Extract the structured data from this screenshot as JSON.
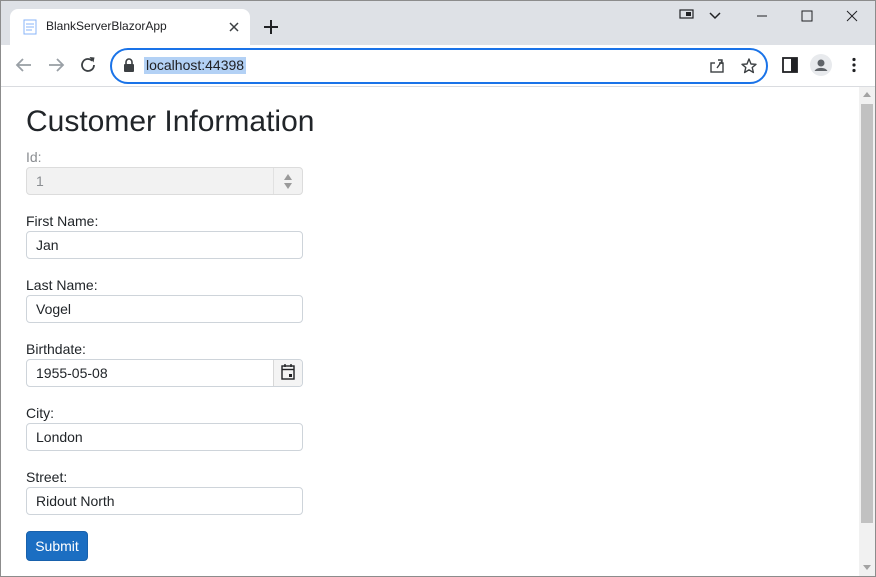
{
  "browser": {
    "tab_title": "BlankServerBlazorApp",
    "url": "localhost:44398",
    "icons": {
      "favicon": "page-icon",
      "tab_close": "close-icon",
      "new_tab": "plus-icon",
      "back": "arrow-left-icon",
      "forward": "arrow-right-icon",
      "reload": "reload-icon",
      "lock": "lock-icon",
      "share": "share-icon",
      "bookmark": "star-icon",
      "side_panel": "side-panel-icon",
      "profile": "profile-icon",
      "menu": "kebab-menu-icon",
      "tab_search": "chevron-down-icon"
    }
  },
  "page": {
    "title": "Customer Information",
    "fields": {
      "id": {
        "label": "Id:",
        "value": "1"
      },
      "first_name": {
        "label": "First Name:",
        "value": "Jan"
      },
      "last_name": {
        "label": "Last Name:",
        "value": "Vogel"
      },
      "birthdate": {
        "label": "Birthdate:",
        "value": "1955-05-08"
      },
      "city": {
        "label": "City:",
        "value": "London"
      },
      "street": {
        "label": "Street:",
        "value": "Ridout North"
      }
    },
    "submit_label": "Submit"
  },
  "colors": {
    "accent": "#1b6ec2",
    "omnibox_border": "#1a73e8",
    "url_highlight": "#b3d1f5",
    "tabstrip": "#dee1e6"
  }
}
